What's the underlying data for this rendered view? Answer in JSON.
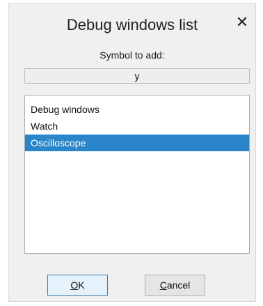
{
  "dialog": {
    "title": "Debug windows list",
    "close_icon": "close-icon",
    "symbol_label": "Symbol to add:",
    "symbol_value": "y"
  },
  "list": {
    "items": [
      {
        "label": "Debug windows",
        "selected": false
      },
      {
        "label": "Watch",
        "selected": false
      },
      {
        "label": "Oscilloscope",
        "selected": true
      }
    ]
  },
  "buttons": {
    "ok": {
      "mnemonic": "O",
      "rest": "K"
    },
    "cancel": {
      "mnemonic": "C",
      "rest": "ancel"
    }
  },
  "colors": {
    "dialog_bg": "#f0f0f0",
    "selection": "#2a86c9",
    "default_button_border": "#3c7fb1"
  }
}
